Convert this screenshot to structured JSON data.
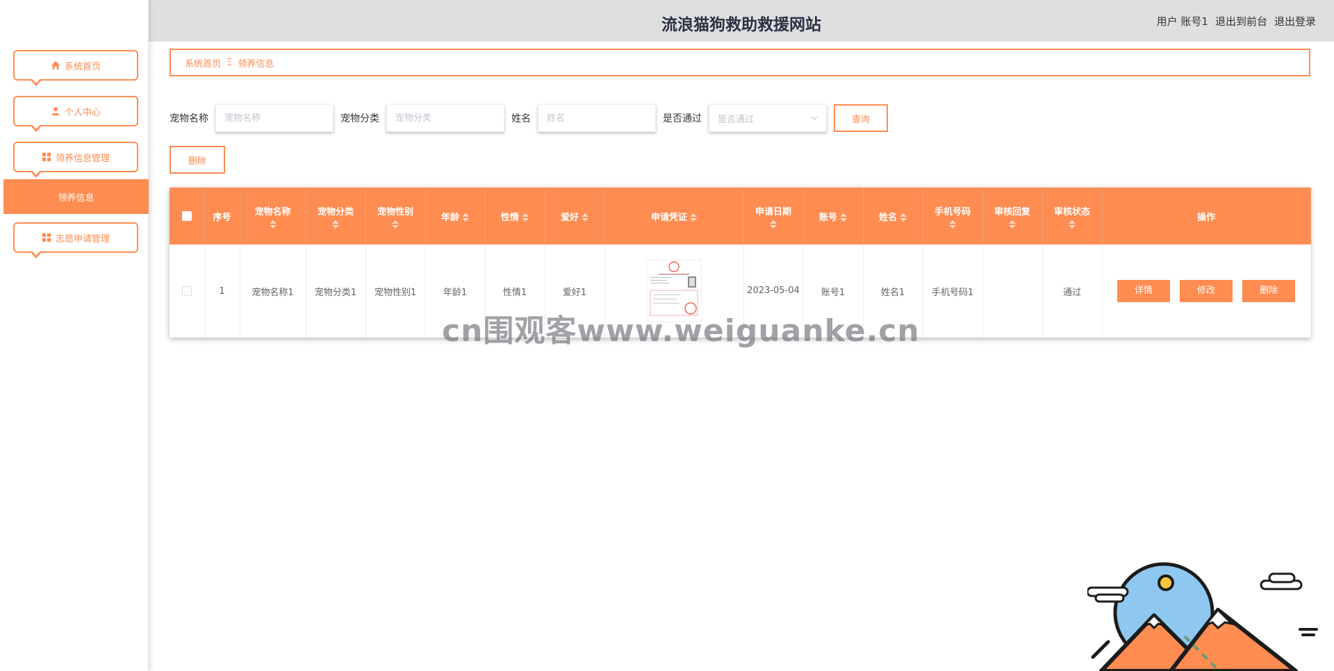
{
  "header": {
    "title": "流浪猫狗救助救援网站",
    "user_prefix": "用户",
    "user_name": "账号1",
    "exit_front": "退出到前台",
    "logout": "退出登录"
  },
  "sidebar": {
    "items": [
      {
        "label": "系统首页",
        "icon": "home-icon"
      },
      {
        "label": "个人中心",
        "icon": "user-icon"
      },
      {
        "label": "领养信息管理",
        "icon": "grid-icon"
      },
      {
        "label": "志愿申请管理",
        "icon": "grid-icon"
      }
    ],
    "active_sub": "领养信息"
  },
  "breadcrumb": {
    "home": "系统首页",
    "separator": "Ξ",
    "current": "领养信息"
  },
  "search": {
    "pet_name_label": "宠物名称",
    "pet_name_placeholder": "宠物名称",
    "pet_category_label": "宠物分类",
    "pet_category_placeholder": "宠物分类",
    "name_label": "姓名",
    "name_placeholder": "姓名",
    "approved_label": "是否通过",
    "approved_placeholder": "是否通过",
    "query_button": "查询"
  },
  "actions": {
    "delete_button": "删除"
  },
  "table": {
    "headers": {
      "index": "序号",
      "pet_name": "宠物名称",
      "pet_category": "宠物分类",
      "pet_gender": "宠物性别",
      "age": "年龄",
      "temperament": "性情",
      "hobby": "爱好",
      "voucher": "申请凭证",
      "apply_date": "申请日期",
      "account": "账号",
      "name": "姓名",
      "phone": "手机号码",
      "review_reply": "审核回复",
      "review_status": "审核状态",
      "operation": "操作"
    },
    "rows": [
      {
        "index": "1",
        "pet_name": "宠物名称1",
        "pet_category": "宠物分类1",
        "pet_gender": "宠物性别1",
        "age": "年龄1",
        "temperament": "性情1",
        "hobby": "爱好1",
        "apply_date": "2023-05-04",
        "account": "账号1",
        "name": "姓名1",
        "phone": "手机号码1",
        "review_reply": "",
        "review_status": "通过",
        "btn_detail": "详情",
        "btn_edit": "修改",
        "btn_delete": "删除"
      }
    ]
  },
  "watermark": "cn围观客www.weiguanke.cn",
  "colors": {
    "accent": "#ff8c50",
    "header_bg": "#e0dfe0",
    "title": "#2a3144"
  }
}
